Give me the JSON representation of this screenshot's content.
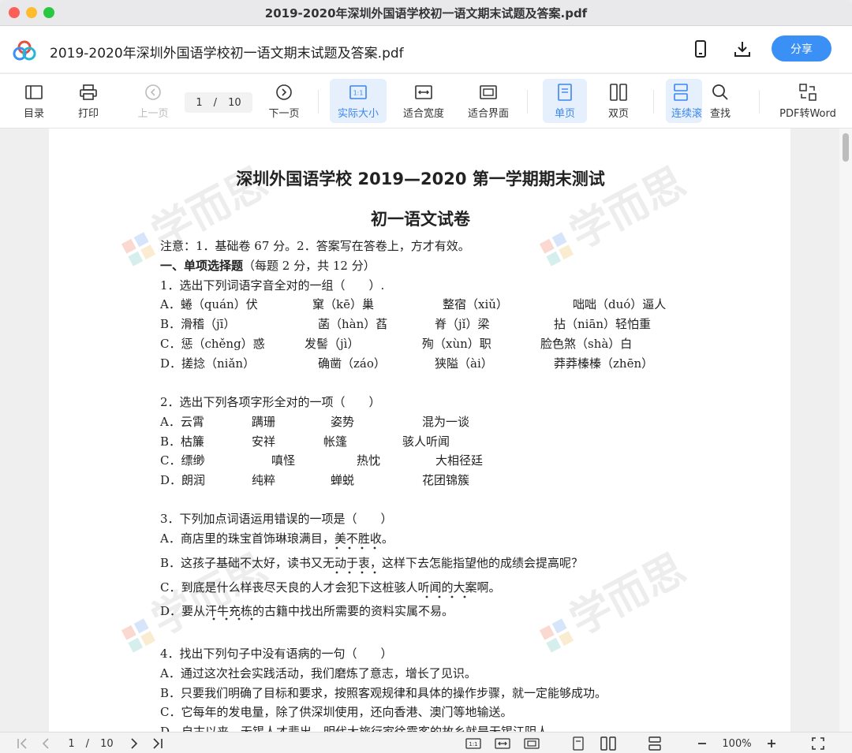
{
  "window": {
    "title": "2019-2020年深圳外国语学校初一语文期末试题及答案.pdf"
  },
  "appbar": {
    "file_title": "2019-2020年深圳外国语学校初一语文期末试题及答案.pdf",
    "share_label": "分享",
    "phone_icon": "phone-icon",
    "download_icon": "download-icon"
  },
  "toolbar": {
    "toc": "目录",
    "print": "打印",
    "prev": "上一页",
    "page_current": "1",
    "page_sep": "/",
    "page_total": "10",
    "next": "下一页",
    "actual_size": "实际大小",
    "fit_width": "适合宽度",
    "fit_screen": "适合界面",
    "single": "单页",
    "double": "双页",
    "continuous": "连续滚",
    "search": "查找",
    "pdf_to_word": "PDF转Word"
  },
  "watermark": "学而思",
  "document": {
    "title1": "深圳外国语学校 2019—2020 第一学期期末测试",
    "title2": "初一语文试卷",
    "note": "注意：1．基础卷 67 分。2．答案写在答卷上，方才有效。",
    "section_bold": "一、单项选择题",
    "section_rest": "（每题 2 分，共 12 分）",
    "q1": "1．选出下列词语字音全对的一组（　　）.",
    "q1_options": [
      [
        "A．蜷（quán）伏",
        "窠（kē）巢",
        "整宿（xiǔ）",
        "咄咄（duó）逼人"
      ],
      [
        "B．滑稽（jī）",
        "菡（hàn）萏",
        "脊（jǐ）梁",
        "拈（niān）轻怕重"
      ],
      [
        "C．惩（chěng）惑",
        "发髻（jì）",
        "殉（xùn）职",
        "脸色煞（shà）白"
      ],
      [
        "D．搓捻（niǎn）",
        "确凿（záo）",
        "狭隘（ài）",
        "莽莽榛榛（zhēn）"
      ]
    ],
    "q2": "2．选出下列各项字形全对的一项（　　）",
    "q2_options": [
      [
        "A．云霄",
        "蹒珊",
        "姿势",
        "混为一谈"
      ],
      [
        "B．枯簾",
        "安祥",
        "帐篷",
        "骇人听闻"
      ],
      [
        "C．缥缈",
        "嗔怪",
        "热忱",
        "大相径廷"
      ],
      [
        "D．朗润",
        "纯粹",
        "蝉蜕",
        "花团锦簇"
      ]
    ],
    "q3": "3．下列加点词语运用错误的一项是（　　）",
    "q3_options": [
      "A．商店里的珠宝首饰琳琅满目，美不胜收。",
      "B．这孩子基础不太好，读书又无动于衷，这样下去怎能指望他的成绩会提高呢？",
      "C．到底是什么样丧尽天良的人才会犯下这桩骇人听闻的大案啊。",
      "D．要从汗牛充栋的古籍中找出所需要的资料实属不易。"
    ],
    "q4": "4．找出下列句子中没有语病的一句（　　）",
    "q4_options": [
      "A．通过这次社会实践活动，我们磨炼了意志，增长了见识。",
      "B．只要我们明确了目标和要求，按照客观规律和具体的操作步骤，就一定能够成功。",
      "C．它每年的发电量，除了供深圳使用，还向香港、澳门等地输送。",
      "D．自古以来，无锡人才辈出，明代大旅行家徐霞客的故乡就是无锡江阴人。"
    ]
  },
  "bottombar": {
    "page_current": "1",
    "page_sep": "/",
    "page_total": "10",
    "zoom": "100%"
  }
}
